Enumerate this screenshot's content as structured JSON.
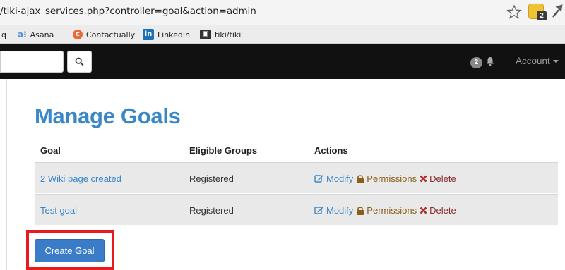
{
  "browser": {
    "url": "/tiki-ajax_services.php?controller=goal&action=admin",
    "extension_badge": "2"
  },
  "bookmarks": [
    {
      "label": "q",
      "icon": ""
    },
    {
      "label": "Asana",
      "icon": "asana-icon"
    },
    {
      "label": "Contactually",
      "icon": "contactually-icon"
    },
    {
      "label": "LinkedIn",
      "icon": "linkedin-icon"
    },
    {
      "label": "tiki/tiki",
      "icon": "tiki-icon"
    }
  ],
  "navbar": {
    "search_value": "",
    "notification_count": "2",
    "account_label": "Account"
  },
  "page": {
    "title": "Manage Goals",
    "columns": [
      "Goal",
      "Eligible Groups",
      "Actions"
    ],
    "rows": [
      {
        "goal": "2 Wiki page created",
        "groups": "Registered",
        "modify": "Modify",
        "permissions": "Permissions",
        "delete": "Delete"
      },
      {
        "goal": "Test goal",
        "groups": "Registered",
        "modify": "Modify",
        "permissions": "Permissions",
        "delete": "Delete"
      }
    ],
    "create_button": "Create Goal"
  },
  "colors": {
    "link": "#3a87c8",
    "navbar": "#111111",
    "button": "#3a7cc8",
    "highlight": "#e8191f"
  }
}
